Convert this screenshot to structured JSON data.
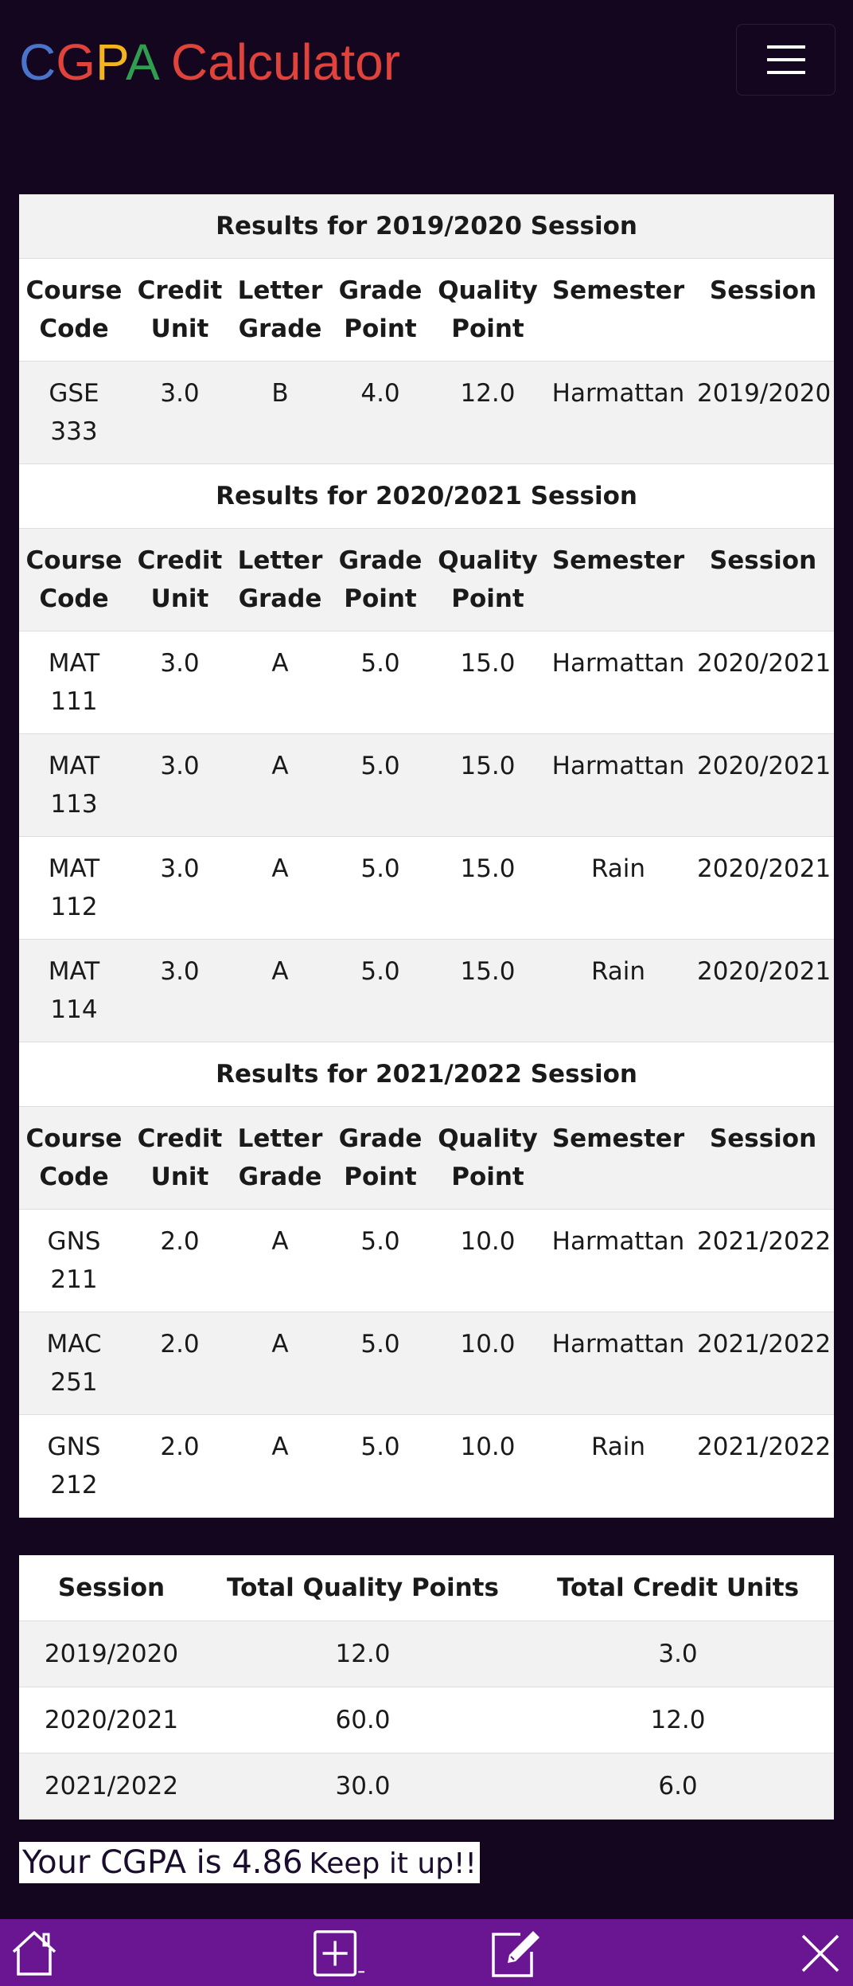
{
  "app": {
    "logo_letters": [
      {
        "char": "C",
        "color": "#4a74c9"
      },
      {
        "char": "G",
        "color": "#e0433b"
      },
      {
        "char": "P",
        "color": "#f2b51d"
      },
      {
        "char": "A",
        "color": "#2f9e4f"
      },
      {
        "char": " ",
        "color": "#e0433b"
      },
      {
        "char": "Calculator",
        "color": "#e0433b"
      }
    ]
  },
  "menu": {
    "icon": "hamburger-icon"
  },
  "results": {
    "headers": [
      "Course Code",
      "Credit Unit",
      "Letter Grade",
      "Grade Point",
      "Quality Point",
      "Semester",
      "Session"
    ],
    "sessions": [
      {
        "title": "Results for 2019/2020 Session",
        "rows": [
          [
            "GSE 333",
            "3.0",
            "B",
            "4.0",
            "12.0",
            "Harmattan",
            "2019/2020"
          ]
        ]
      },
      {
        "title": "Results for 2020/2021 Session",
        "rows": [
          [
            "MAT 111",
            "3.0",
            "A",
            "5.0",
            "15.0",
            "Harmattan",
            "2020/2021"
          ],
          [
            "MAT 113",
            "3.0",
            "A",
            "5.0",
            "15.0",
            "Harmattan",
            "2020/2021"
          ],
          [
            "MAT 112",
            "3.0",
            "A",
            "5.0",
            "15.0",
            "Rain",
            "2020/2021"
          ],
          [
            "MAT 114",
            "3.0",
            "A",
            "5.0",
            "15.0",
            "Rain",
            "2020/2021"
          ]
        ]
      },
      {
        "title": "Results for 2021/2022 Session",
        "rows": [
          [
            "GNS 211",
            "2.0",
            "A",
            "5.0",
            "10.0",
            "Harmattan",
            "2021/2022"
          ],
          [
            "MAC 251",
            "2.0",
            "A",
            "5.0",
            "10.0",
            "Harmattan",
            "2021/2022"
          ],
          [
            "GNS 212",
            "2.0",
            "A",
            "5.0",
            "10.0",
            "Rain",
            "2021/2022"
          ]
        ]
      }
    ]
  },
  "summary": {
    "headers": [
      "Session",
      "Total Quality Points",
      "Total Credit Units"
    ],
    "rows": [
      [
        "2019/2020",
        "12.0",
        "3.0"
      ],
      [
        "2020/2021",
        "60.0",
        "12.0"
      ],
      [
        "2021/2022",
        "30.0",
        "6.0"
      ]
    ]
  },
  "cgpa": {
    "label": "Your CGPA is 4.86",
    "message": "Keep it up!!"
  },
  "bottom_bar": {
    "icons": [
      "home-icon",
      "add-icon",
      "edit-icon",
      "close-icon"
    ],
    "color": "#6a1693"
  }
}
